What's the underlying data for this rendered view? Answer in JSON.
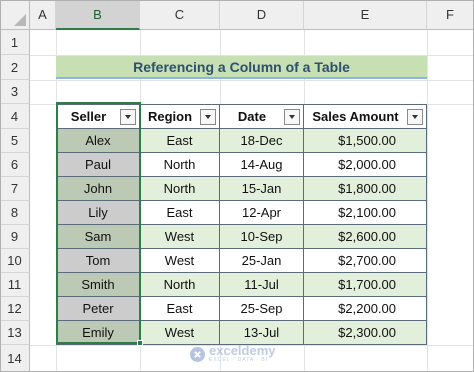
{
  "columns": [
    "A",
    "B",
    "C",
    "D",
    "E",
    "F"
  ],
  "rows": [
    "1",
    "2",
    "3",
    "4",
    "5",
    "6",
    "7",
    "8",
    "9",
    "10",
    "11",
    "12",
    "13",
    "14"
  ],
  "title": "Referencing a Column of a Table",
  "table": {
    "headers": [
      "Seller",
      "Region",
      "Date",
      "Sales Amount"
    ],
    "rows": [
      [
        "Alex",
        "East",
        "18-Dec",
        "$1,500.00"
      ],
      [
        "Paul",
        "North",
        "14-Aug",
        "$2,000.00"
      ],
      [
        "John",
        "North",
        "15-Jan",
        "$1,800.00"
      ],
      [
        "Lily",
        "East",
        "12-Apr",
        "$2,100.00"
      ],
      [
        "Sam",
        "West",
        "10-Sep",
        "$2,600.00"
      ],
      [
        "Tom",
        "West",
        "25-Jan",
        "$2,700.00"
      ],
      [
        "Smith",
        "North",
        "11-Jul",
        "$1,700.00"
      ],
      [
        "Peter",
        "East",
        "25-Sep",
        "$2,200.00"
      ],
      [
        "Emily",
        "West",
        "13-Jul",
        "$2,300.00"
      ]
    ]
  },
  "watermark": {
    "name": "exceldemy",
    "tagline": "EXCEL · DATA · BI"
  },
  "colors": {
    "accent_green": "#2e7d46",
    "band": "#e2efda",
    "title_fill": "#c6e0b4"
  }
}
